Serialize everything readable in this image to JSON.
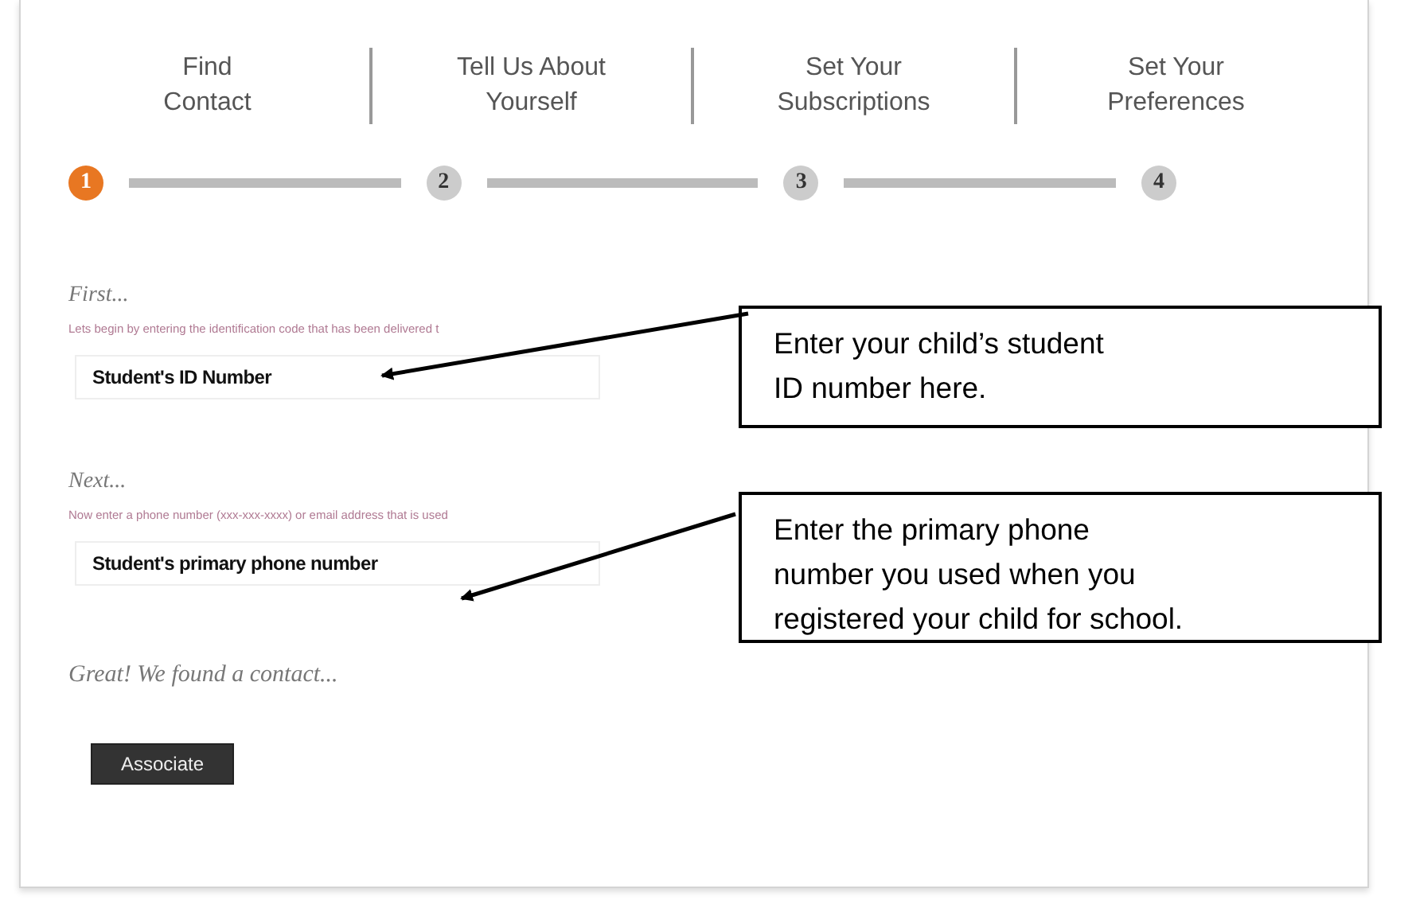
{
  "steps": [
    {
      "number": "1",
      "label": "Find\nContact",
      "selected": true
    },
    {
      "number": "2",
      "label": "Tell Us About\nYourself",
      "selected": false
    },
    {
      "number": "3",
      "label": "Set Your\nSubscriptions",
      "selected": false
    },
    {
      "number": "4",
      "label": "Set Your\nPreferences",
      "selected": false
    }
  ],
  "sections": [
    {
      "heading": "First...",
      "instruction": "Lets begin by entering the identification code that has been delivered t",
      "value": "Student's ID Number"
    },
    {
      "heading": "Next...",
      "instruction": "Now enter a phone number (xxx-xxx-xxxx) or email address that is used",
      "value": "Student's primary phone number"
    }
  ],
  "result": {
    "message": "Great! We found a contact...",
    "button": "Associate"
  },
  "callouts": [
    {
      "text": "Enter your child’s student\nID number here."
    },
    {
      "text": "Enter the primary phone\nnumber you used when you\nregistered your child for school."
    }
  ]
}
